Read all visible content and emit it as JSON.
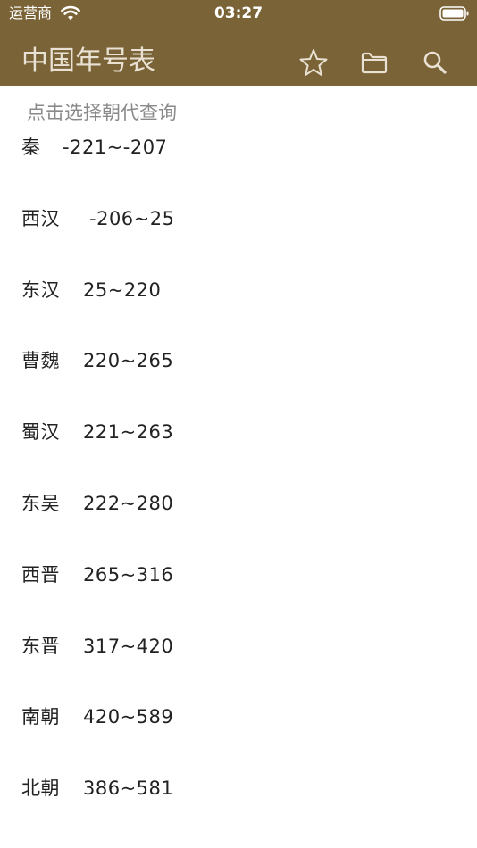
{
  "status_bar": {
    "carrier": "运营商",
    "time": "03:27"
  },
  "nav": {
    "title": "中国年号表",
    "icons": [
      "star-icon",
      "folder-icon",
      "search-icon"
    ]
  },
  "hint": "点击选择朝代查询",
  "dynasties": [
    {
      "name": "秦",
      "range": "-221~-207"
    },
    {
      "name": "西汉",
      "range": "-206~25"
    },
    {
      "name": "东汉",
      "range": "25~220"
    },
    {
      "name": "曹魏",
      "range": "220~265"
    },
    {
      "name": "蜀汉",
      "range": "221~263"
    },
    {
      "name": "东吴",
      "range": "222~280"
    },
    {
      "name": "西晋",
      "range": "265~316"
    },
    {
      "name": "东晋",
      "range": "317~420"
    },
    {
      "name": "南朝",
      "range": "420~589"
    },
    {
      "name": "北朝",
      "range": "386~581"
    }
  ],
  "colors": {
    "header_bg": "#7a6336",
    "title_text": "#e9e2d4",
    "hint_text": "#8a8a8a",
    "row_text": "#222222"
  }
}
